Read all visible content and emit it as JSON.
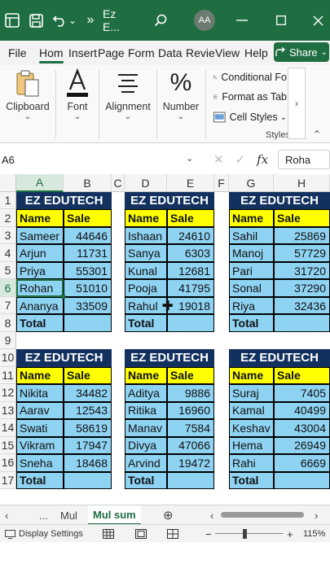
{
  "titlebar": {
    "overflow_icon": "»",
    "title": "Ez E...",
    "undo_chevron": "⌄",
    "avatar_initials": "AA"
  },
  "tabs": [
    "File",
    "Hom",
    "Insert",
    "Page",
    "Form",
    "Data",
    "Revie",
    "View",
    "Help"
  ],
  "share": {
    "label": "Share",
    "chevron": "⌄"
  },
  "ribbon": {
    "clipboard": "Clipboard",
    "font": "Font",
    "alignment": "Alignment",
    "number": "Number",
    "number_symbol": "%",
    "chevron": "⌄",
    "conditional_formatting": "Conditional Fo",
    "format_as_table": "Format as Tab",
    "cell_styles": "Cell Styles",
    "styles_group": "Styles",
    "scroll_right": "›",
    "collapse": "⌃"
  },
  "formula_bar": {
    "name_box": "A6",
    "cancel": "✕",
    "enter": "✓",
    "fx": "fx",
    "content": "Roha"
  },
  "columns": [
    "A",
    "B",
    "C",
    "D",
    "E",
    "F",
    "G",
    "H"
  ],
  "rows": [
    "1",
    "2",
    "3",
    "4",
    "5",
    "6",
    "7",
    "8",
    "9",
    "10",
    "11",
    "12",
    "13",
    "14",
    "15",
    "16",
    "17"
  ],
  "tables": [
    {
      "title": "EZ EDUTECH",
      "name_header": "Name",
      "sale_header": "Sale",
      "rows": [
        [
          "Sameer",
          "44646"
        ],
        [
          "Arjun",
          "11731"
        ],
        [
          "Priya",
          "55301"
        ],
        [
          "Rohan",
          "51010"
        ],
        [
          "Ananya",
          "33509"
        ]
      ],
      "total": "Total"
    },
    {
      "title": "EZ EDUTECH",
      "name_header": "Name",
      "sale_header": "Sale",
      "rows": [
        [
          "Ishaan",
          "24610"
        ],
        [
          "Sanya",
          "6303"
        ],
        [
          "Kunal",
          "12681"
        ],
        [
          "Pooja",
          "41795"
        ],
        [
          "Rahul",
          "19018"
        ]
      ],
      "total": "Total"
    },
    {
      "title": "EZ EDUTECH",
      "name_header": "Name",
      "sale_header": "Sale",
      "rows": [
        [
          "Sahil",
          "25869"
        ],
        [
          "Manoj",
          "57729"
        ],
        [
          "Pari",
          "31720"
        ],
        [
          "Sonal",
          "37290"
        ],
        [
          "Riya",
          "32436"
        ]
      ],
      "total": "Total"
    },
    {
      "title": "EZ EDUTECH",
      "name_header": "Name",
      "sale_header": "Sale",
      "rows": [
        [
          "Nikita",
          "34482"
        ],
        [
          "Aarav",
          "12543"
        ],
        [
          "Swati",
          "58619"
        ],
        [
          "Vikram",
          "17947"
        ],
        [
          "Sneha",
          "18468"
        ]
      ],
      "total": "Total"
    },
    {
      "title": "EZ EDUTECH",
      "name_header": "Name",
      "sale_header": "Sale",
      "rows": [
        [
          "Aditya",
          "9886"
        ],
        [
          "Ritika",
          "16960"
        ],
        [
          "Manav",
          "7584"
        ],
        [
          "Divya",
          "47066"
        ],
        [
          "Arvind",
          "19472"
        ]
      ],
      "total": "Total"
    },
    {
      "title": "EZ EDUTECH",
      "name_header": "Name",
      "sale_header": "Sale",
      "rows": [
        [
          "Suraj",
          "7405"
        ],
        [
          "Kamal",
          "40499"
        ],
        [
          "Keshav",
          "43004"
        ],
        [
          "Hema",
          "26949"
        ],
        [
          "Rahi",
          "6669"
        ]
      ],
      "total": "Total"
    }
  ],
  "sheets": {
    "prev": "‹",
    "ellipsis": "...",
    "tabs": [
      "Mul",
      "Mul sum"
    ],
    "active": "Mul sum",
    "add": "⊕",
    "next": "›"
  },
  "status": {
    "display_settings": "Display Settings",
    "zoom_minus": "−",
    "zoom_plus": "+",
    "zoom": "115%"
  },
  "colors": {
    "title_bar": "#1e6e42",
    "table_header": "#13315f",
    "column_header": "#ffff00",
    "data_fill": "#8fd3f3"
  }
}
